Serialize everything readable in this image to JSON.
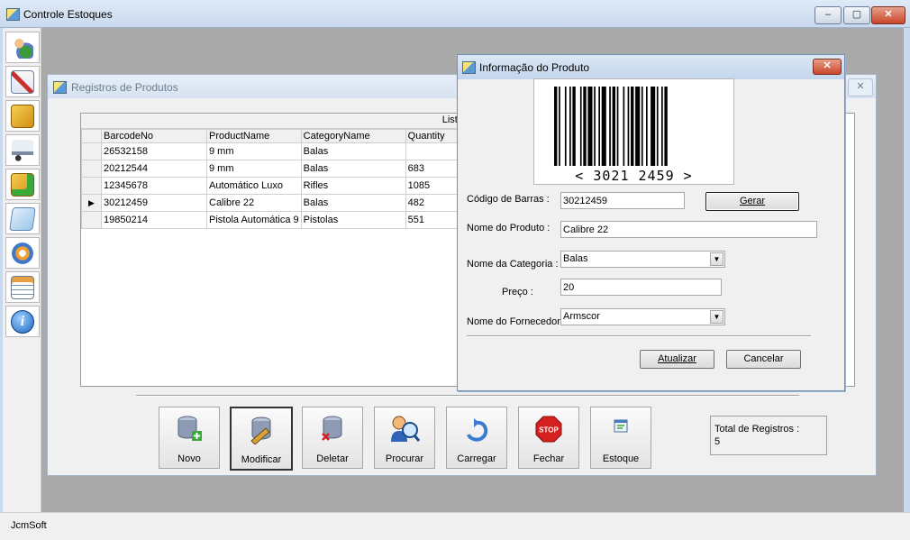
{
  "app": {
    "title": "Controle Estoques",
    "status": "JcmSoft"
  },
  "window_buttons": {
    "minimize": "–",
    "maximize": "▢",
    "close": "✕"
  },
  "toolbar_icons": [
    "users-icon",
    "edit-icon",
    "products-icon",
    "delivery-icon",
    "stock-in-icon",
    "report-icon",
    "settings-icon",
    "document-icon",
    "info-icon"
  ],
  "child": {
    "title": "Registros de Produtos",
    "grid": {
      "caption": "Lista de",
      "columns": [
        "BarcodeNo",
        "ProductName",
        "CategoryName",
        "Quantity"
      ],
      "rows": [
        {
          "marker": "",
          "cells": [
            "26532158",
            "9 mm",
            "Balas",
            ""
          ]
        },
        {
          "marker": "",
          "cells": [
            "20212544",
            "9 mm",
            "Balas",
            "683"
          ]
        },
        {
          "marker": "",
          "cells": [
            "12345678",
            "Automático Luxo",
            "Rifles",
            "1085"
          ]
        },
        {
          "marker": "▶",
          "cells": [
            "30212459",
            "Calibre 22",
            "Balas",
            "482"
          ]
        },
        {
          "marker": "",
          "cells": [
            "19850214",
            "Pistola Automática 9",
            "Pistolas",
            "551"
          ]
        }
      ]
    },
    "buttons": {
      "novo": "Novo",
      "modificar": "Modificar",
      "deletar": "Deletar",
      "procurar": "Procurar",
      "carregar": "Carregar",
      "fechar": "Fechar",
      "estoque": "Estoque"
    },
    "total": {
      "label": "Total de Registros :",
      "value": "5"
    }
  },
  "dialog": {
    "title": "Informação do Produto",
    "barcode_text": "< 3021 2459 >",
    "barcode_label": "Código de Barras :",
    "barcode_value": "30212459",
    "gerar": "Gerar",
    "name_label": "Nome do Produto :",
    "name_value": "Calibre 22",
    "category_label": "Nome da Categoria :",
    "category_value": "Balas",
    "price_label": "Preço :",
    "price_value": "20",
    "supplier_label": "Nome do Fornecedor",
    "supplier_value": "Armscor",
    "atualizar": "Atualizar",
    "cancelar": "Cancelar"
  }
}
